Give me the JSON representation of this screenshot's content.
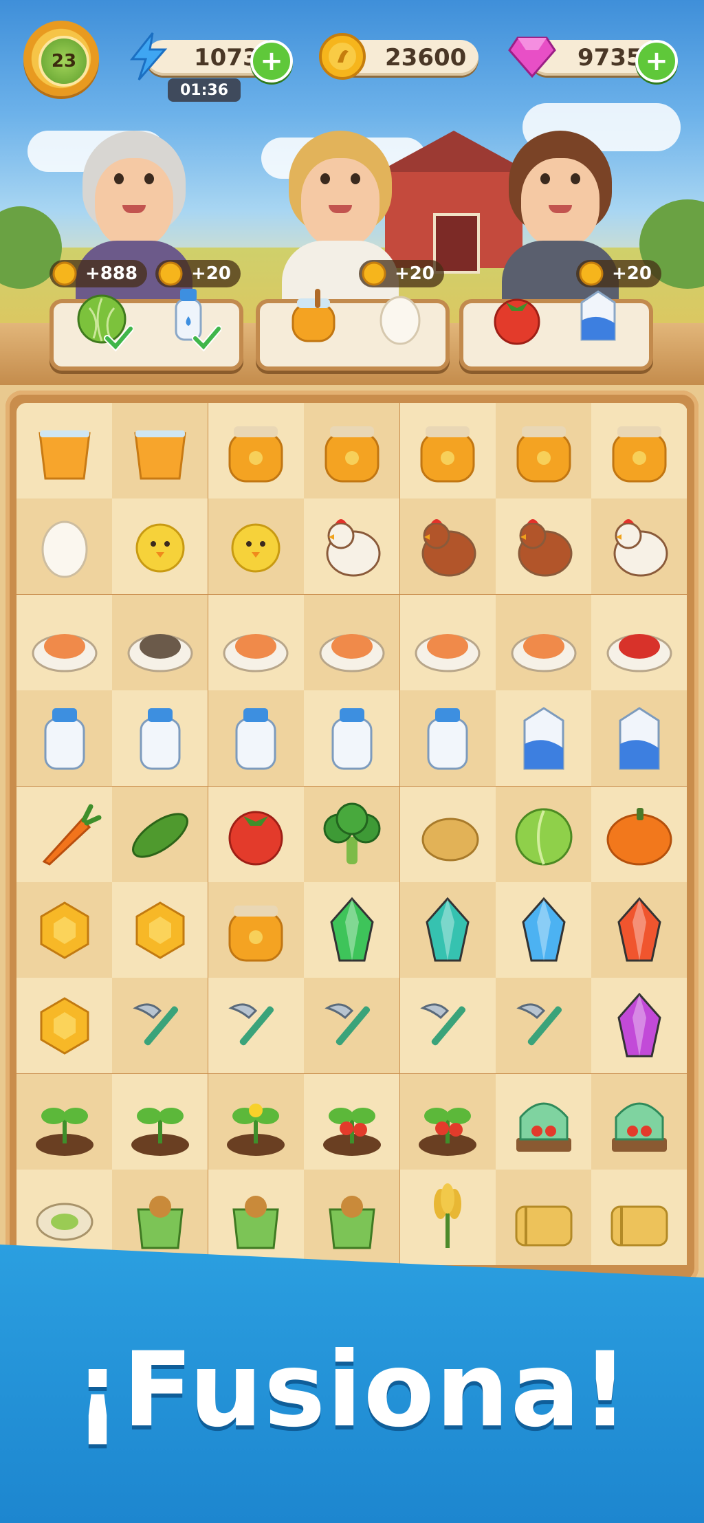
{
  "hud": {
    "level": "23",
    "energy": "1073",
    "energy_timer": "01:36",
    "coins": "23600",
    "gems": "9735"
  },
  "orders": [
    {
      "character": "grandma",
      "rewards": [
        "+888",
        "+20"
      ],
      "items": [
        "cabbage-icon",
        "milk-bottle-icon"
      ],
      "completed": [
        true,
        true
      ]
    },
    {
      "character": "farm-girl",
      "rewards": [
        "+20"
      ],
      "items": [
        "honey-jar-icon",
        "egg-icon"
      ],
      "completed": [
        false,
        false
      ]
    },
    {
      "character": "farm-boy",
      "rewards": [
        "+20"
      ],
      "items": [
        "tomato-icon",
        "milk-carton-icon"
      ],
      "completed": [
        false,
        false
      ]
    }
  ],
  "board": [
    [
      "juice-glass-icon",
      "juice-bowl-icon",
      "pineapple-bowl-icon",
      "pineapple-jam-jar-icon",
      "pineapple-jam-tagged-icon",
      "jam-jar-cloth-icon",
      "jam-jar-bow-icon"
    ],
    [
      "egg-icon",
      "hatching-chick-icon",
      "chick-icon",
      "hen-white-icon",
      "rooster-icon",
      "hen-brown-icon",
      "fluffy-hen-icon"
    ],
    [
      "salmon-roe-bowl-icon",
      "oyster-icon",
      "shrimp-plate-icon",
      "salmon-steak-plate-icon",
      "grilled-fish-plate-icon",
      "shrimp-soup-icon",
      "lobster-plate-icon"
    ],
    [
      "milk-glass-icon",
      "milk-jug-icon",
      "milk-bottle-icon",
      "milk-corked-bottle-icon",
      "milk-jar-icon",
      "milk-carton-blue-icon",
      "milk-carton-cow-icon"
    ],
    [
      "carrot-icon",
      "cucumber-icon",
      "tomato-icon",
      "broccoli-icon",
      "potato-icon",
      "cabbage-icon",
      "pumpkin-icon"
    ],
    [
      "honeycomb-icon",
      "honeycomb-bowl-icon",
      "honey-jar-icon",
      "green-gem-icon",
      "teal-crystal-icon",
      "blue-crystal-icon",
      "red-crystal-icon"
    ],
    [
      "honey-barrel-icon",
      "hand-fork-icon",
      "sickle-icon",
      "hoe-icon",
      "shovel-icon",
      "rake-icon",
      "purple-crystal-icon"
    ],
    [
      "sprout-icon",
      "seedling-icon",
      "flowering-plant-icon",
      "tomato-plant-icon",
      "tomato-bush-icon",
      "greenhouse-small-icon",
      "greenhouse-large-icon"
    ],
    [
      "pistachio-icon",
      "seed-bag-small-icon",
      "seed-bag-icon",
      "basket-icon",
      "wheat-bundle-icon",
      "hay-roll-icon",
      "hay-bale-icon"
    ]
  ],
  "banner": {
    "title": "¡Fusiona!"
  },
  "colors": {
    "banner": "#2b9fe0",
    "board": "#f3ddae",
    "frame": "#c98d4c",
    "plus": "#5fc83a"
  }
}
